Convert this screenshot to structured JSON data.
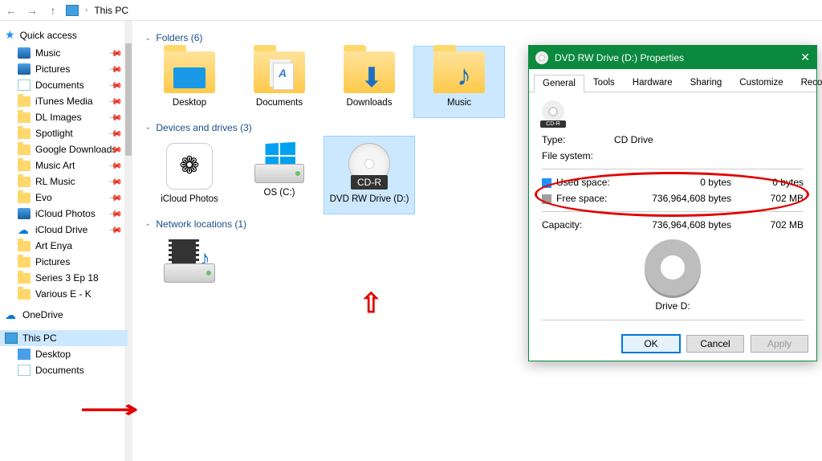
{
  "breadcrumb": {
    "location": "This PC"
  },
  "sidebar": {
    "quick_access": {
      "label": "Quick access"
    },
    "items": [
      {
        "label": "Music",
        "pinned": true,
        "icon": "music"
      },
      {
        "label": "Pictures",
        "pinned": true,
        "icon": "pic"
      },
      {
        "label": "Documents",
        "pinned": true,
        "icon": "doc"
      },
      {
        "label": "iTunes Media",
        "pinned": true,
        "icon": "folder"
      },
      {
        "label": "DL Images",
        "pinned": true,
        "icon": "folder"
      },
      {
        "label": "Spotlight",
        "pinned": true,
        "icon": "folder"
      },
      {
        "label": "Google Downloads",
        "pinned": true,
        "icon": "folder"
      },
      {
        "label": "Music Art",
        "pinned": true,
        "icon": "folder"
      },
      {
        "label": "RL Music",
        "pinned": true,
        "icon": "folder"
      },
      {
        "label": "Evo",
        "pinned": true,
        "icon": "folder"
      },
      {
        "label": "iCloud Photos",
        "pinned": true,
        "icon": "pic"
      },
      {
        "label": "iCloud Drive",
        "pinned": true,
        "icon": "cloud"
      },
      {
        "label": "Art Enya",
        "pinned": false,
        "icon": "folder"
      },
      {
        "label": "Pictures",
        "pinned": false,
        "icon": "folder"
      },
      {
        "label": "Series 3 Ep 18",
        "pinned": false,
        "icon": "folder"
      },
      {
        "label": "Various E - K",
        "pinned": false,
        "icon": "folder"
      }
    ],
    "onedrive": {
      "label": "OneDrive"
    },
    "this_pc": {
      "label": "This PC"
    },
    "desktop": {
      "label": "Desktop"
    },
    "documents": {
      "label": "Documents"
    }
  },
  "sections": {
    "folders": {
      "title": "Folders (6)",
      "items": [
        "Desktop",
        "Documents",
        "Downloads",
        "Music"
      ]
    },
    "drives": {
      "title": "Devices and drives (3)",
      "items": [
        "iCloud Photos",
        "OS (C:)",
        "DVD RW Drive (D:)"
      ],
      "cdr_badge": "CD-R"
    },
    "network": {
      "title": "Network locations (1)"
    }
  },
  "dialog": {
    "title": "DVD RW Drive (D:) Properties",
    "tabs": [
      "General",
      "Tools",
      "Hardware",
      "Sharing",
      "Customize",
      "Recording"
    ],
    "type_label": "Type:",
    "type_value": "CD Drive",
    "fs_label": "File system:",
    "used_label": "Used space:",
    "used_bytes": "0 bytes",
    "used_h": "0 bytes",
    "free_label": "Free space:",
    "free_bytes": "736,964,608 bytes",
    "free_h": "702 MB",
    "cap_label": "Capacity:",
    "cap_bytes": "736,964,608 bytes",
    "cap_h": "702 MB",
    "drive_label": "Drive D:",
    "ok": "OK",
    "cancel": "Cancel",
    "apply": "Apply"
  }
}
